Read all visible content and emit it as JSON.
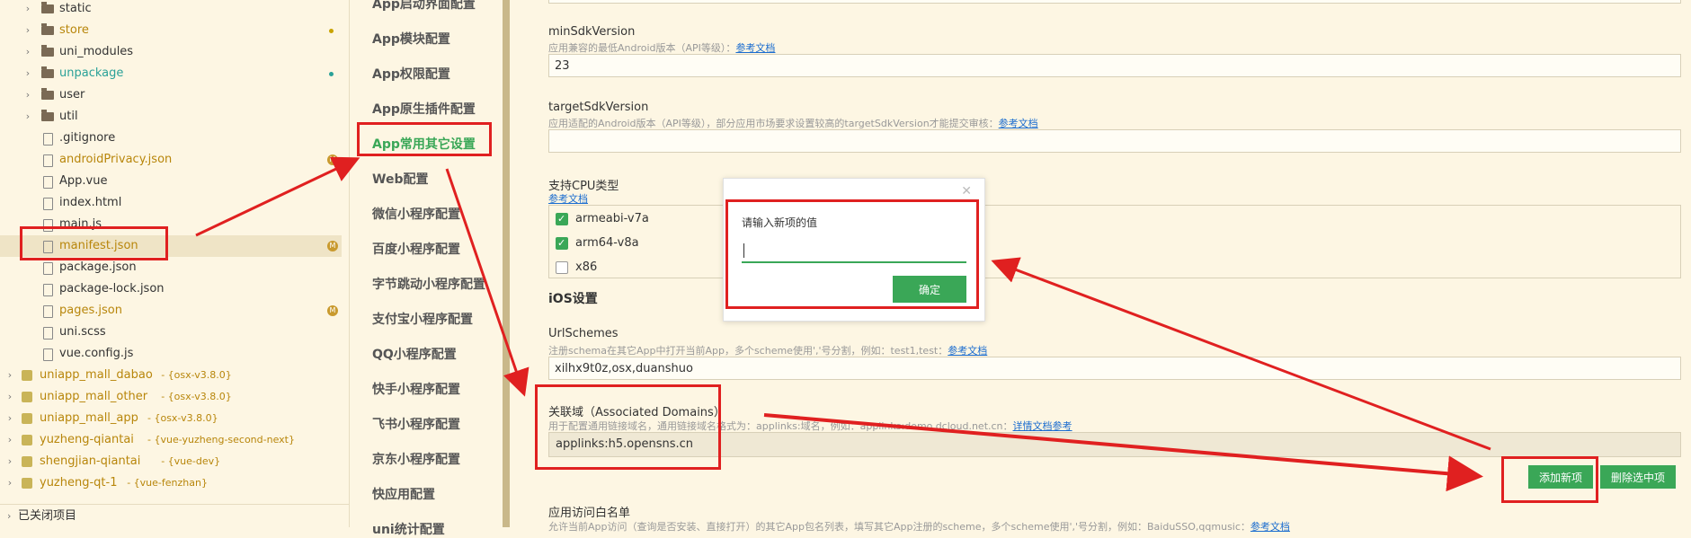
{
  "tree": {
    "items": [
      {
        "label": "static",
        "type": "folder",
        "color": "#333"
      },
      {
        "label": "store",
        "type": "folder",
        "color": "#b8860b",
        "dot": "#c9a300"
      },
      {
        "label": "uni_modules",
        "type": "folder",
        "color": "#333"
      },
      {
        "label": "unpackage",
        "type": "folder",
        "color": "#2aa198",
        "dot": "#2aa198"
      },
      {
        "label": "user",
        "type": "folder",
        "color": "#333"
      },
      {
        "label": "util",
        "type": "folder",
        "color": "#333"
      },
      {
        "label": ".gitignore",
        "type": "file",
        "color": "#333"
      },
      {
        "label": "androidPrivacy.json",
        "type": "file",
        "color": "#b8860b",
        "badge": "M"
      },
      {
        "label": "App.vue",
        "type": "file",
        "color": "#333"
      },
      {
        "label": "index.html",
        "type": "file",
        "color": "#333"
      },
      {
        "label": "main.js",
        "type": "file",
        "color": "#333"
      },
      {
        "label": "manifest.json",
        "type": "file",
        "color": "#b8860b",
        "badge": "M"
      },
      {
        "label": "package.json",
        "type": "file",
        "color": "#333"
      },
      {
        "label": "package-lock.json",
        "type": "file",
        "color": "#333"
      },
      {
        "label": "pages.json",
        "type": "file",
        "color": "#b8860b",
        "badge": "M"
      },
      {
        "label": "uni.scss",
        "type": "file",
        "color": "#333"
      },
      {
        "label": "vue.config.js",
        "type": "file",
        "color": "#333"
      }
    ],
    "projects": [
      {
        "name": "uniapp_mall_dabao",
        "branch": "- {osx-v3.8.0}"
      },
      {
        "name": "uniapp_mall_other",
        "branch": "- {osx-v3.8.0}"
      },
      {
        "name": "uniapp_mall_app",
        "branch": "- {osx-v3.8.0}"
      },
      {
        "name": "yuzheng-qiantai",
        "branch": "- {vue-yuzheng-second-next}"
      },
      {
        "name": "shengjian-qiantai",
        "branch": "- {vue-dev}"
      },
      {
        "name": "yuzheng-qt-1",
        "branch": "- {vue-fenzhan}"
      }
    ],
    "footer": "已关闭项目"
  },
  "nav": {
    "items": [
      "App启动界面配置",
      "App模块配置",
      "App权限配置",
      "App原生插件配置",
      "App常用其它设置",
      "Web配置",
      "微信小程序配置",
      "百度小程序配置",
      "字节跳动小程序配置",
      "支付宝小程序配置",
      "QQ小程序配置",
      "快手小程序配置",
      "飞书小程序配置",
      "京东小程序配置",
      "快应用配置",
      "uni统计配置"
    ],
    "active": "App常用其它设置"
  },
  "form": {
    "minsdk": {
      "label": "minSdkVersion",
      "hint": "应用兼容的最低Android版本（API等级）：",
      "link": "参考文档",
      "value": "23"
    },
    "targetsdk": {
      "label": "targetSdkVersion",
      "hint": "应用适配的Android版本（API等级），部分应用市场要求设置较高的targetSdkVersion才能提交审核：",
      "link": "参考文档",
      "value": ""
    },
    "cpu": {
      "label": "支持CPU类型",
      "link": "参考文档",
      "options": [
        {
          "label": "armeabi-v7a",
          "checked": true
        },
        {
          "label": "arm64-v8a",
          "checked": true
        },
        {
          "label": "x86",
          "checked": false
        }
      ]
    },
    "ios_title": "iOS设置",
    "urlschemes": {
      "label": "UrlSchemes",
      "hint": "注册schema在其它App中打开当前App，多个scheme使用','号分割，例如：test1,test：",
      "link": "参考文档",
      "value": "xilhx9t0z,osx,duanshuo"
    },
    "domains": {
      "label": "关联域（Associated Domains）",
      "hint": "用于配置通用链接域名，通用链接域名格式为：applinks:域名，例如：applinks:demo.dcloud.net.cn：",
      "link": "详情文档参考",
      "value": "applinks:h5.opensns.cn"
    },
    "add_button": "添加新项",
    "delete_button": "删除选中项",
    "whitelist": {
      "label": "应用访问白名单",
      "hint": "允许当前App访问（查询是否安装、直接打开）的其它App包名列表，填写其它App注册的scheme，多个scheme使用','号分割，例如：BaiduSSO,qqmusic：",
      "link": "参考文档"
    }
  },
  "dialog": {
    "title": "请输入新项的值",
    "input_value": "",
    "confirm": "确定"
  }
}
